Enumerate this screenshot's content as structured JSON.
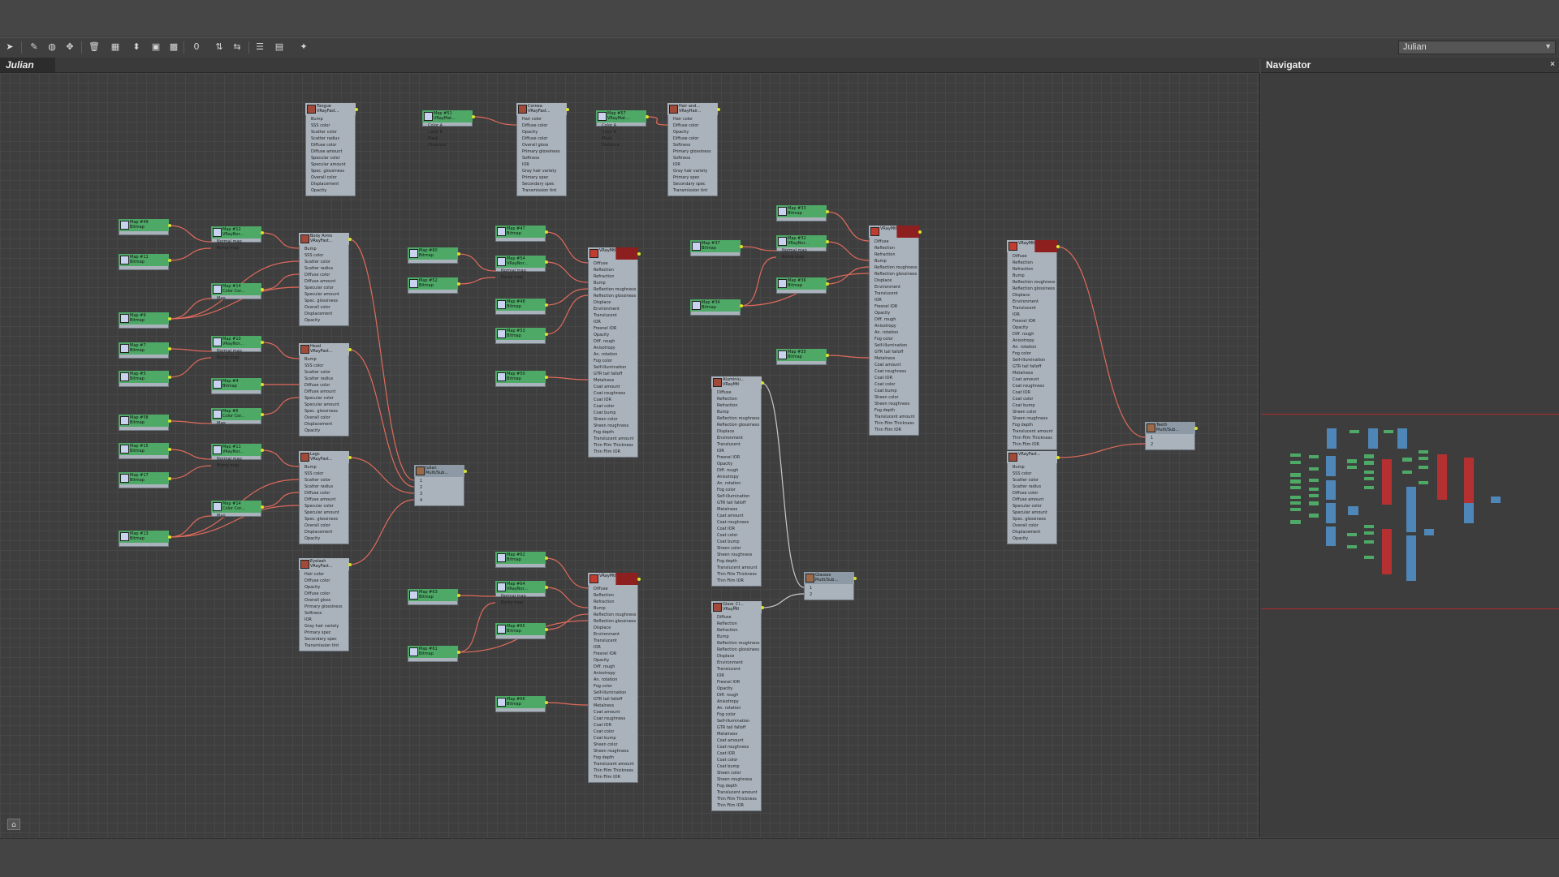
{
  "app": {
    "view_name": "Julian"
  },
  "toolbar": {
    "view_select": "Julian",
    "tools": [
      {
        "name": "select-tool",
        "icon": "arrow-icon",
        "glyph": "➤"
      },
      {
        "name": "pick-tool",
        "icon": "eyedropper-icon",
        "glyph": "✎"
      },
      {
        "name": "render-tool",
        "icon": "sphere-icon",
        "glyph": "◍"
      },
      {
        "name": "move-children-tool",
        "icon": "move-icon",
        "glyph": "✥"
      },
      {
        "name": "delete-tool",
        "icon": "trash-icon",
        "glyph": "🗑"
      },
      {
        "name": "layout-tool",
        "icon": "layout-icon",
        "glyph": "▦"
      },
      {
        "name": "assign-tool",
        "icon": "assign-icon",
        "glyph": "⬍"
      },
      {
        "name": "background-tool",
        "icon": "background-icon",
        "glyph": "▣"
      },
      {
        "name": "checker-tool",
        "icon": "checker-icon",
        "glyph": "▩"
      },
      {
        "name": "material-id-tool",
        "icon": "material-id-icon",
        "glyph": "0"
      },
      {
        "name": "layout-vertical-tool",
        "icon": "layout-vertical-icon",
        "glyph": "⇅"
      },
      {
        "name": "layout-horizontal-tool",
        "icon": "layout-horizontal-icon",
        "glyph": "⇆"
      },
      {
        "name": "list-tool",
        "icon": "list-icon",
        "glyph": "☰"
      },
      {
        "name": "hide-unused-tool",
        "icon": "hide-unused-icon",
        "glyph": "▤"
      },
      {
        "name": "highlight-tool",
        "icon": "highlight-icon",
        "glyph": "✦"
      }
    ]
  },
  "navigator": {
    "title": "Navigator",
    "close": "×"
  },
  "status": {
    "icon_glyph": "⌂"
  },
  "nodes": [
    {
      "id": "n_tongue",
      "kind": "mtl",
      "title": "Tongue",
      "sub": "VRayFast...",
      "ports": [
        "Bump",
        "SSS color",
        "Scatter color",
        "Scatter radius",
        "Diffuse color",
        "Diffuse amount",
        "Specular color",
        "Specular amount",
        "Spec. glossiness",
        "Overall color",
        "Displacement",
        "Opacity"
      ]
    },
    {
      "id": "n_map51",
      "kind": "map",
      "title": "Map #51",
      "sub": "VRayMat...",
      "ports": [
        "Color A",
        "Color B",
        "Mask",
        "Distance"
      ]
    },
    {
      "id": "n_corneaL",
      "kind": "mtl",
      "title": "Cornea",
      "sub": "VRayFast...",
      "ports": [
        "Hair color",
        "Diffuse color",
        "Opacity",
        "Diffuse color",
        "Overall gloss",
        "Primary glossiness",
        "Softness",
        "IOR",
        "Gray hair variety",
        "Primary spec",
        "Secondary spec",
        "Transmission tint"
      ]
    },
    {
      "id": "n_map57",
      "kind": "map",
      "title": "Map #57",
      "sub": "VRayMat...",
      "ports": [
        "Color A",
        "Color B",
        "Mask",
        "Distance"
      ]
    },
    {
      "id": "n_hair",
      "kind": "mtl",
      "title": "Hair and...",
      "sub": "VRayHair...",
      "ports": [
        "Hair color",
        "Diffuse color",
        "Opacity",
        "Diffuse color",
        "Softness",
        "Primary glossiness",
        "Softness",
        "IOR",
        "Gray hair variety",
        "Primary spec",
        "Secondary spec",
        "Transmission tint"
      ]
    },
    {
      "id": "n_map49",
      "kind": "map",
      "title": "Map #49",
      "sub": "Bitmap"
    },
    {
      "id": "n_map11",
      "kind": "map",
      "title": "Map #11",
      "sub": "Bitmap"
    },
    {
      "id": "n_map12",
      "kind": "map",
      "title": "Map #12",
      "sub": "VRayNor...",
      "ports": [
        "Normal map",
        "Bump map"
      ]
    },
    {
      "id": "n_map9",
      "kind": "map",
      "title": "Map #9",
      "sub": "Bitmap"
    },
    {
      "id": "n_cc1",
      "kind": "map",
      "title": "Map #14",
      "sub": "Color Cor...",
      "ports": [
        "Map"
      ]
    },
    {
      "id": "n_body",
      "kind": "mtl",
      "title": "Body Arms",
      "sub": "VRayFast...",
      "ports": [
        "Bump",
        "SSS color",
        "Scatter color",
        "Scatter radius",
        "Diffuse color",
        "Diffuse amount",
        "Specular color",
        "Specular amount",
        "Spec. glossiness",
        "Overall color",
        "Displacement",
        "Opacity"
      ]
    },
    {
      "id": "n_map7",
      "kind": "map",
      "title": "Map #7",
      "sub": "Bitmap"
    },
    {
      "id": "n_map5",
      "kind": "map",
      "title": "Map #5",
      "sub": "Bitmap"
    },
    {
      "id": "n_map10",
      "kind": "map",
      "title": "Map #10",
      "sub": "VRayNor...",
      "ports": [
        "Normal map",
        "Bump map"
      ]
    },
    {
      "id": "n_map4",
      "kind": "map",
      "title": "Map #4",
      "sub": "Bitmap"
    },
    {
      "id": "n_head",
      "kind": "mtl",
      "title": "Head",
      "sub": "VRayFast...",
      "ports": [
        "Bump",
        "SSS color",
        "Scatter color",
        "Scatter radius",
        "Diffuse color",
        "Diffuse amount",
        "Specular color",
        "Specular amount",
        "Spec. glossiness",
        "Overall color",
        "Displacement",
        "Opacity"
      ]
    },
    {
      "id": "n_map58",
      "kind": "map",
      "title": "Map #58",
      "sub": "Bitmap"
    },
    {
      "id": "n_cc2",
      "kind": "map",
      "title": "Map #6",
      "sub": "Color Cor...",
      "ports": [
        "Map"
      ]
    },
    {
      "id": "n_map15",
      "kind": "map",
      "title": "Map #15",
      "sub": "Bitmap"
    },
    {
      "id": "n_map17",
      "kind": "map",
      "title": "Map #17",
      "sub": "Bitmap"
    },
    {
      "id": "n_map11b",
      "kind": "map",
      "title": "Map #11",
      "sub": "VRayNor...",
      "ports": [
        "Normal map",
        "Bump map"
      ]
    },
    {
      "id": "n_cc3",
      "kind": "map",
      "title": "Map #14",
      "sub": "Color Cor...",
      "ports": [
        "Map"
      ]
    },
    {
      "id": "n_map13",
      "kind": "map",
      "title": "Map #13",
      "sub": "Bitmap"
    },
    {
      "id": "n_legs",
      "kind": "mtl",
      "title": "Legs",
      "sub": "VRayFast...",
      "ports": [
        "Bump",
        "SSS color",
        "Scatter color",
        "Scatter radius",
        "Diffuse color",
        "Diffuse amount",
        "Specular color",
        "Specular amount",
        "Spec. glossiness",
        "Overall color",
        "Displacement",
        "Opacity"
      ]
    },
    {
      "id": "n_eyelash",
      "kind": "mtl",
      "title": "Eyelash",
      "sub": "VRayFast...",
      "ports": [
        "Hair color",
        "Diffuse color",
        "Opacity",
        "Diffuse color",
        "Overall gloss",
        "Primary glossiness",
        "Softness",
        "IOR",
        "Gray hair variety",
        "Primary spec",
        "Secondary spec",
        "Transmission tint"
      ]
    },
    {
      "id": "n_julian",
      "kind": "multi",
      "title": "Julian",
      "sub": "Multi/Sub...",
      "ports": [
        "1",
        "2",
        "3",
        "4"
      ]
    },
    {
      "id": "n_map60",
      "kind": "map",
      "title": "Map #60",
      "sub": "Bitmap"
    },
    {
      "id": "n_map52",
      "kind": "map",
      "title": "Map #52",
      "sub": "Bitmap"
    },
    {
      "id": "n_map47",
      "kind": "map",
      "title": "Map #47",
      "sub": "Bitmap"
    },
    {
      "id": "n_map54",
      "kind": "map",
      "title": "Map #54",
      "sub": "VRayNor...",
      "ports": [
        "Normal map",
        "Bump map"
      ]
    },
    {
      "id": "n_map48",
      "kind": "map",
      "title": "Map #48",
      "sub": "Bitmap"
    },
    {
      "id": "n_map53",
      "kind": "map",
      "title": "Map #53",
      "sub": "Bitmap"
    },
    {
      "id": "n_map50",
      "kind": "map",
      "title": "Map #50",
      "sub": "Bitmap"
    },
    {
      "id": "n_vmtl1",
      "kind": "vmtl",
      "title": "",
      "sub": "VRayMtl",
      "ports": [
        "Diffuse",
        "Reflection",
        "Refraction",
        "Bump",
        "Reflection roughness",
        "Reflection glossiness",
        "Displace",
        "Environment",
        "Translucent",
        "IOR",
        "Fresnel IOR",
        "Opacity",
        "Diff. rough",
        "Anisotropy",
        "An. rotation",
        "Fog color",
        "Self-illumination",
        "GTR tail falloff",
        "Metalness",
        "Coat amount",
        "Coat roughness",
        "Coat IOR",
        "Coat color",
        "Coat bump",
        "Sheen color",
        "Sheen roughness",
        "Fog depth",
        "Translucent amount",
        "Thin Film Thickness",
        "Thin Film IOR"
      ]
    },
    {
      "id": "n_map62",
      "kind": "map",
      "title": "Map #62",
      "sub": "Bitmap"
    },
    {
      "id": "n_map63",
      "kind": "map",
      "title": "Map #63",
      "sub": "Bitmap"
    },
    {
      "id": "n_map64",
      "kind": "map",
      "title": "Map #64",
      "sub": "VRayNor...",
      "ports": [
        "Normal map",
        "Bump map"
      ]
    },
    {
      "id": "n_map61",
      "kind": "map",
      "title": "Map #61",
      "sub": "Bitmap"
    },
    {
      "id": "n_map65",
      "kind": "map",
      "title": "Map #65",
      "sub": "Bitmap"
    },
    {
      "id": "n_map66",
      "kind": "map",
      "title": "Map #66",
      "sub": "Bitmap"
    },
    {
      "id": "n_vmtl2",
      "kind": "vmtl",
      "title": "",
      "sub": "VRayMtl",
      "ports": [
        "Diffuse",
        "Reflection",
        "Refraction",
        "Bump",
        "Reflection roughness",
        "Reflection glossiness",
        "Displace",
        "Environment",
        "Translucent",
        "IOR",
        "Fresnel IOR",
        "Opacity",
        "Diff. rough",
        "Anisotropy",
        "An. rotation",
        "Fog color",
        "Self-illumination",
        "GTR tail falloff",
        "Metalness",
        "Coat amount",
        "Coat roughness",
        "Coat IOR",
        "Coat color",
        "Coat bump",
        "Sheen color",
        "Sheen roughness",
        "Fog depth",
        "Translucent amount",
        "Thin Film Thickness",
        "Thin Film IOR"
      ]
    },
    {
      "id": "n_alum",
      "kind": "mtl",
      "title": "Aluminiu...",
      "sub": "VRayMtl",
      "ports": [
        "Diffuse",
        "Reflection",
        "Refraction",
        "Bump",
        "Reflection roughness",
        "Reflection glossiness",
        "Displace",
        "Environment",
        "Translucent",
        "IOR",
        "Fresnel IOR",
        "Opacity",
        "Diff. rough",
        "Anisotropy",
        "An. rotation",
        "Fog color",
        "Self-illumination",
        "GTR tail falloff",
        "Metalness",
        "Coat amount",
        "Coat roughness",
        "Coat IOR",
        "Coat color",
        "Coat bump",
        "Sheen color",
        "Sheen roughness",
        "Fog depth",
        "Translucent amount",
        "Thin Film Thickness",
        "Thin Film IOR"
      ]
    },
    {
      "id": "n_glass",
      "kind": "mtl",
      "title": "Glass_Cl...",
      "sub": "VRayMtl",
      "ports": [
        "Diffuse",
        "Reflection",
        "Refraction",
        "Bump",
        "Reflection roughness",
        "Reflection glossiness",
        "Displace",
        "Environment",
        "Translucent",
        "IOR",
        "Fresnel IOR",
        "Opacity",
        "Diff. rough",
        "Anisotropy",
        "An. rotation",
        "Fog color",
        "Self-illumination",
        "GTR tail falloff",
        "Metalness",
        "Coat amount",
        "Coat roughness",
        "Coat IOR",
        "Coat color",
        "Coat bump",
        "Sheen color",
        "Sheen roughness",
        "Fog depth",
        "Translucent amount",
        "Thin Film Thickness",
        "Thin Film IOR"
      ]
    },
    {
      "id": "n_glasses",
      "kind": "multi",
      "title": "Glasses",
      "sub": "Multi/Sub...",
      "ports": [
        "1",
        "2"
      ]
    },
    {
      "id": "n_map33",
      "kind": "map",
      "title": "Map #33",
      "sub": "Bitmap"
    },
    {
      "id": "n_map37",
      "kind": "map",
      "title": "Map #37",
      "sub": "Bitmap"
    },
    {
      "id": "n_map32",
      "kind": "map",
      "title": "Map #32",
      "sub": "VRayNor...",
      "ports": [
        "Normal map",
        "Bump map"
      ]
    },
    {
      "id": "n_map36",
      "kind": "map",
      "title": "Map #36",
      "sub": "Bitmap"
    },
    {
      "id": "n_map34",
      "kind": "map",
      "title": "Map #34",
      "sub": "Bitmap"
    },
    {
      "id": "n_map35",
      "kind": "map",
      "title": "Map #35",
      "sub": "Bitmap"
    },
    {
      "id": "n_vmtl3",
      "kind": "vmtl",
      "title": "",
      "sub": "VRayMtl",
      "ports": [
        "Diffuse",
        "Reflection",
        "Refraction",
        "Bump",
        "Reflection roughness",
        "Reflection glossiness",
        "Displace",
        "Environment",
        "Translucent",
        "IOR",
        "Fresnel IOR",
        "Opacity",
        "Diff. rough",
        "Anisotropy",
        "An. rotation",
        "Fog color",
        "Self-illumination",
        "GTR tail falloff",
        "Metalness",
        "Coat amount",
        "Coat roughness",
        "Coat IOR",
        "Coat color",
        "Coat bump",
        "Sheen color",
        "Sheen roughness",
        "Fog depth",
        "Translucent amount",
        "Thin Film Thickness",
        "Thin Film IOR"
      ]
    },
    {
      "id": "n_vmtl4",
      "kind": "vmtl",
      "title": "",
      "sub": "VRayMtl",
      "ports": [
        "Diffuse",
        "Reflection",
        "Refraction",
        "Bump",
        "Reflection roughness",
        "Reflection glossiness",
        "Displace",
        "Environment",
        "Translucent",
        "IOR",
        "Fresnel IOR",
        "Opacity",
        "Diff. rough",
        "Anisotropy",
        "An. rotation",
        "Fog color",
        "Self-illumination",
        "GTR tail falloff",
        "Metalness",
        "Coat amount",
        "Coat roughness",
        "Coat IOR",
        "Coat color",
        "Coat bump",
        "Sheen color",
        "Sheen roughness",
        "Fog depth",
        "Translucent amount",
        "Thin Film Thickness",
        "Thin Film IOR"
      ]
    },
    {
      "id": "n_vfast",
      "kind": "mtl",
      "title": "",
      "sub": "VRayFast...",
      "ports": [
        "Bump",
        "SSS color",
        "Scatter color",
        "Scatter radius",
        "Diffuse color",
        "Diffuse amount",
        "Specular color",
        "Specular amount",
        "Spec. glossiness",
        "Overall color",
        "Displacement",
        "Opacity"
      ]
    },
    {
      "id": "n_teeth",
      "kind": "multi",
      "title": "Teeth",
      "sub": "Multi/Sub...",
      "ports": [
        "1",
        "2"
      ]
    }
  ]
}
